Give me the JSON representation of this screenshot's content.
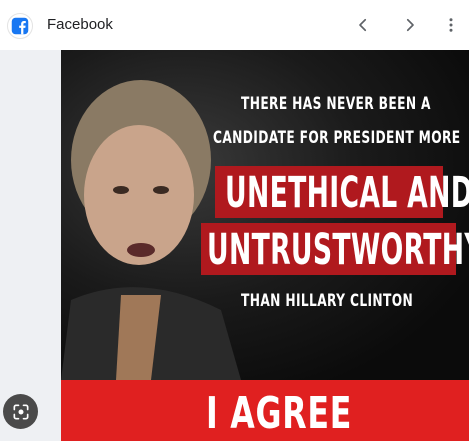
{
  "header": {
    "site_name": "Facebook",
    "logo_icon": "facebook-icon",
    "back_icon": "chevron-left-icon",
    "forward_icon": "chevron-right-icon",
    "more_icon": "more-vertical-icon",
    "brand_color": "#1877f2"
  },
  "sidebar": {
    "lens_icon": "image-search-icon"
  },
  "meme": {
    "line1": "THERE HAS NEVER BEEN A",
    "line2": "CANDIDATE FOR PRESIDENT MORE",
    "line3": "UNETHICAL AND",
    "line4": "UNTRUSTWORTHY",
    "line5": "THAN HILLARY CLINTON",
    "agree": "I AGREE",
    "accent_color": "#e02020"
  }
}
